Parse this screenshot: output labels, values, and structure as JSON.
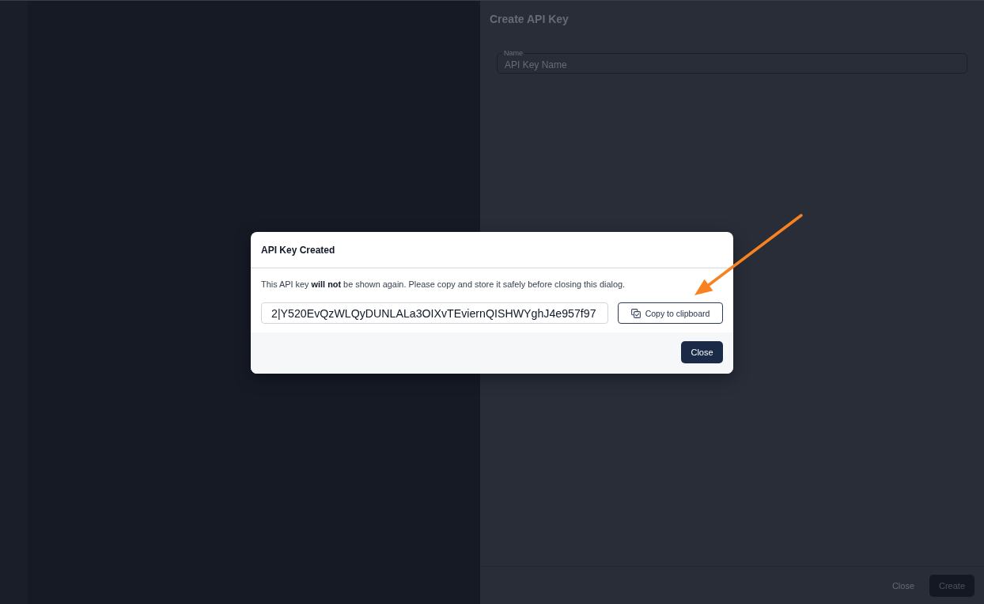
{
  "drawer": {
    "title": "Create API Key",
    "name_field": {
      "label": "Name",
      "placeholder": "API Key Name"
    },
    "buttons": [
      {
        "label": "Close",
        "kind": "text"
      },
      {
        "label": "Create",
        "kind": "primary"
      }
    ]
  },
  "dialog": {
    "title": "API Key Created",
    "message": "This API key **will not** be shown again. Please copy and store it safely before closing this dialog.",
    "key_field": {
      "value": "2|Y520EvQzWLQyDUNLALa3OIXvTEviernQISHWYghJ4e957f97"
    },
    "copy_button": {
      "label": "Copy to clipboard"
    },
    "close_button": {
      "label": "Close"
    }
  }
}
